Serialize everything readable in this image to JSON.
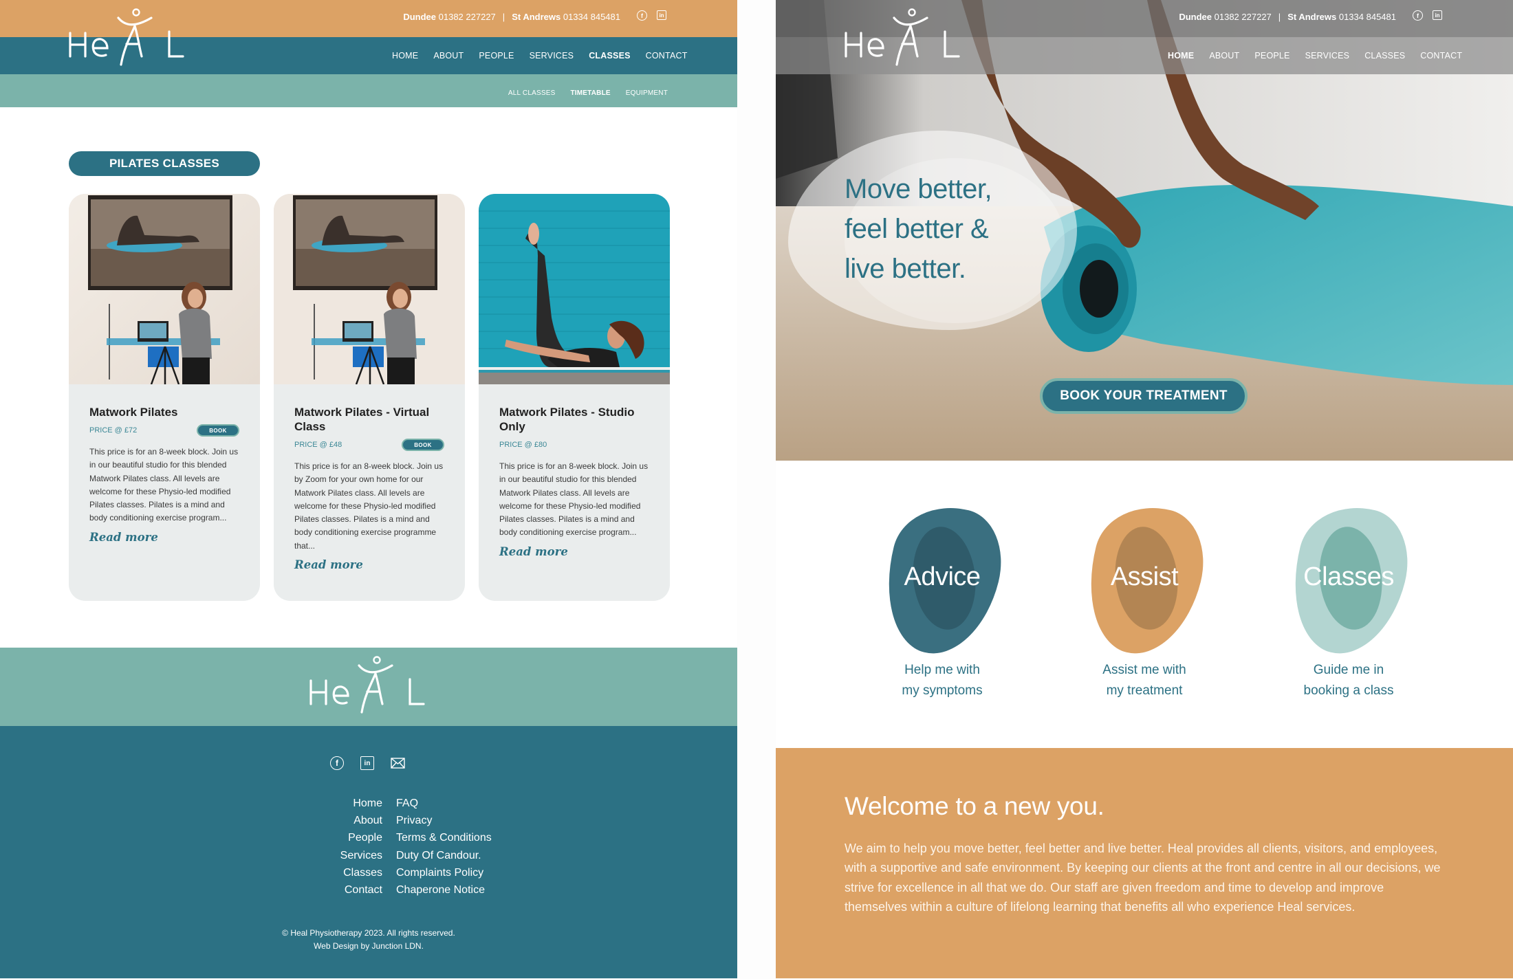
{
  "brand": {
    "logo_text": "HeAL",
    "colors": {
      "orange": "#dca265",
      "teal": "#2c7184",
      "sage": "#7bb3aa",
      "card_bg": "#eaeded",
      "light_sage": "#b3d5d1"
    }
  },
  "header": {
    "contacts": [
      {
        "location": "Dundee",
        "phone": "01382 227227"
      },
      {
        "location": "St Andrews",
        "phone": "01334 845481"
      }
    ],
    "separator": "|",
    "social_icons": [
      "facebook-icon",
      "linkedin-icon"
    ],
    "facebook_glyph": "f",
    "linkedin_glyph": "in"
  },
  "classes_page": {
    "nav": [
      {
        "label": "HOME",
        "active": false
      },
      {
        "label": "ABOUT",
        "active": false
      },
      {
        "label": "PEOPLE",
        "active": false
      },
      {
        "label": "SERVICES",
        "active": false
      },
      {
        "label": "CLASSES",
        "active": true
      },
      {
        "label": "CONTACT",
        "active": false
      }
    ],
    "subnav": [
      {
        "label": "ALL CLASSES",
        "active": false
      },
      {
        "label": "TIMETABLE",
        "active": true
      },
      {
        "label": "EQUIPMENT",
        "active": false
      }
    ],
    "section_title": "PILATES CLASSES",
    "cards": [
      {
        "title": "Matwork Pilates",
        "price": "PRICE @ £72",
        "book_label": "BOOK",
        "has_book": true,
        "description": "This price is for an 8-week block. Join us in our beautiful studio for this blended Matwork Pilates class. All levels are welcome for these Physio-led modified Pilates classes.  Pilates is a mind and body conditioning exercise program...",
        "read_more": "Read more"
      },
      {
        "title": "Matwork Pilates - Virtual Class",
        "price": "PRICE @ £48",
        "book_label": "BOOK",
        "has_book": true,
        "description": "This price is for an 8-week block. Join us by Zoom for your own home for our Matwork Pilates class. All levels are welcome for these Physio-led modified Pilates classes.  Pilates is a mind and body conditioning exercise programme that...",
        "read_more": "Read more"
      },
      {
        "title": "Matwork Pilates - Studio Only",
        "price": "PRICE @ £80",
        "book_label": "",
        "has_book": false,
        "description": "This price is for an 8-week block. Join us in our beautiful studio for this blended Matwork Pilates class. All levels are welcome for these Physio-led modified Pilates classes.  Pilates is a mind and body conditioning exercise program...",
        "read_more": "Read more"
      }
    ],
    "footer": {
      "links_left": [
        "Home",
        "About",
        "People",
        "Services",
        "Classes",
        "Contact"
      ],
      "links_right": [
        "FAQ",
        "Privacy",
        "Terms & Conditions",
        "Duty Of Candour.",
        "Complaints Policy",
        "Chaperone Notice"
      ],
      "copyright": "© Heal Physiotherapy 2023. All rights reserved.",
      "credit": "Web Design by Junction LDN."
    }
  },
  "home_page": {
    "nav": [
      {
        "label": "HOME",
        "active": true
      },
      {
        "label": "ABOUT",
        "active": false
      },
      {
        "label": "PEOPLE",
        "active": false
      },
      {
        "label": "SERVICES",
        "active": false
      },
      {
        "label": "CLASSES",
        "active": false
      },
      {
        "label": "CONTACT",
        "active": false
      }
    ],
    "hero": {
      "headline_lines": [
        "Move better,",
        "feel better &",
        "live better."
      ],
      "cta": "BOOK YOUR TREATMENT"
    },
    "pathways": [
      {
        "label": "Advice",
        "caption_lines": [
          "Help me with",
          "my symptoms"
        ],
        "outer": "#3a6f80",
        "inner": "#2f5b6a"
      },
      {
        "label": "Assist",
        "caption_lines": [
          "Assist me with",
          "my treatment"
        ],
        "outer": "#dca265",
        "inner": "#b38553"
      },
      {
        "label": "Classes",
        "caption_lines": [
          "Guide me in",
          "booking a class"
        ],
        "outer": "#b3d5d1",
        "inner": "#7bb3aa"
      }
    ],
    "welcome": {
      "title": "Welcome to a new you.",
      "body": "We aim to help you move better, feel better and live better. Heal provides all clients, visitors, and employees, with a supportive and safe environment. By keeping our clients at the front and centre in all our decisions, we strive for excellence in all that we do. Our staff are given freedom and time to develop and improve themselves within a culture of lifelong learning that benefits all who experience Heal services."
    }
  }
}
